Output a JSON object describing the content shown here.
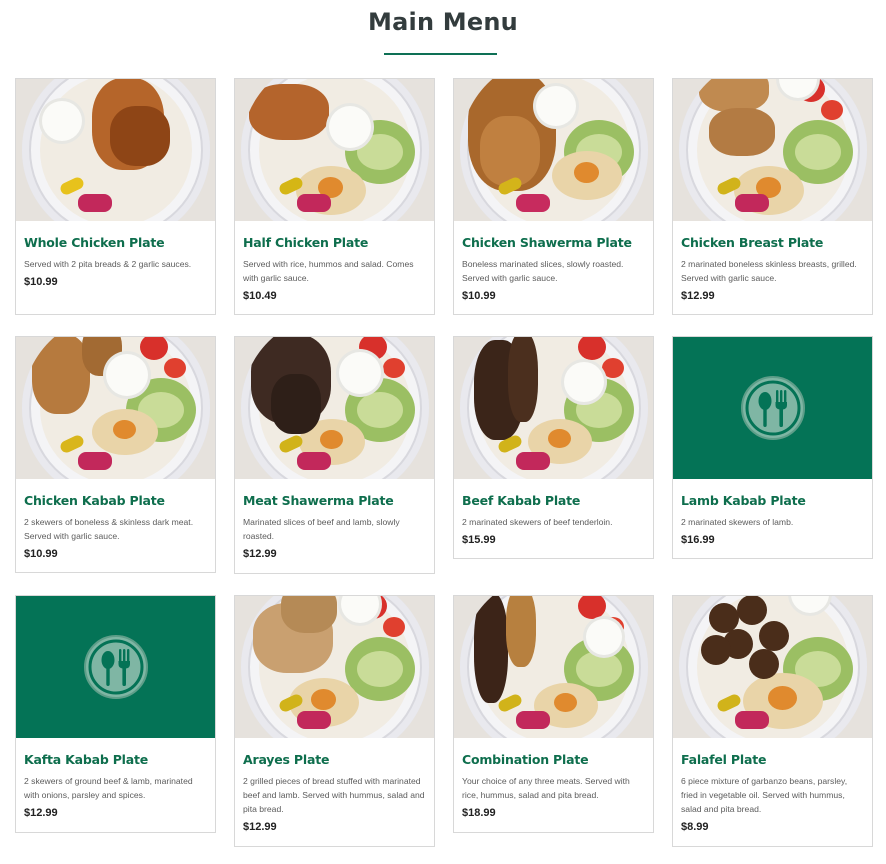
{
  "page": {
    "title": "Main Menu",
    "accent": "#0e7055",
    "placeholder_bg": "#047356"
  },
  "items": [
    {
      "name": "Whole Chicken Plate",
      "desc": "Served with 2 pita breads & 2 garlic sauces.",
      "price": "$10.99",
      "image": "whole-chicken-photo"
    },
    {
      "name": "Half Chicken Plate",
      "desc": "Served with rice, hummos and salad. Comes with garlic sauce.",
      "price": "$10.49",
      "image": "half-chicken-photo"
    },
    {
      "name": "Chicken Shawerma Plate",
      "desc": "Boneless marinated slices, slowly roasted. Served with garlic sauce.",
      "price": "$10.99",
      "image": "chicken-shawerma-photo"
    },
    {
      "name": "Chicken Breast Plate",
      "desc": "2 marinated boneless skinless breasts, grilled. Served with garlic sauce.",
      "price": "$12.99",
      "image": "chicken-breast-photo"
    },
    {
      "name": "Chicken Kabab Plate",
      "desc": "2 skewers of boneless & skinless dark meat. Served with garlic sauce.",
      "price": "$10.99",
      "image": "chicken-kabab-photo"
    },
    {
      "name": "Meat Shawerma Plate",
      "desc": "Marinated slices of beef and lamb, slowly roasted.",
      "price": "$12.99",
      "image": "meat-shawerma-photo"
    },
    {
      "name": "Beef Kabab Plate",
      "desc": "2 marinated skewers of beef tenderloin.",
      "price": "$15.99",
      "image": "beef-kabab-photo"
    },
    {
      "name": "Lamb Kabab Plate",
      "desc": "2 marinated skewers of lamb.",
      "price": "$16.99",
      "image": "placeholder-utensils"
    },
    {
      "name": "Kafta Kabab Plate",
      "desc": "2 skewers of ground beef & lamb, marinated with onions, parsley and spices.",
      "price": "$12.99",
      "image": "placeholder-utensils"
    },
    {
      "name": "Arayes Plate",
      "desc": "2 grilled pieces of bread stuffed with marinated beef and lamb. Served with hummus, salad and pita bread.",
      "price": "$12.99",
      "image": "arayes-photo"
    },
    {
      "name": "Combination Plate",
      "desc": "Your choice of any three meats. Served with rice, hummus, salad and pita bread.",
      "price": "$18.99",
      "image": "combination-photo"
    },
    {
      "name": "Falafel Plate",
      "desc": "6 piece mixture of garbanzo beans, parsley, fried in vegetable oil. Served with hummus, salad and pita bread.",
      "price": "$8.99",
      "image": "falafel-photo"
    }
  ]
}
